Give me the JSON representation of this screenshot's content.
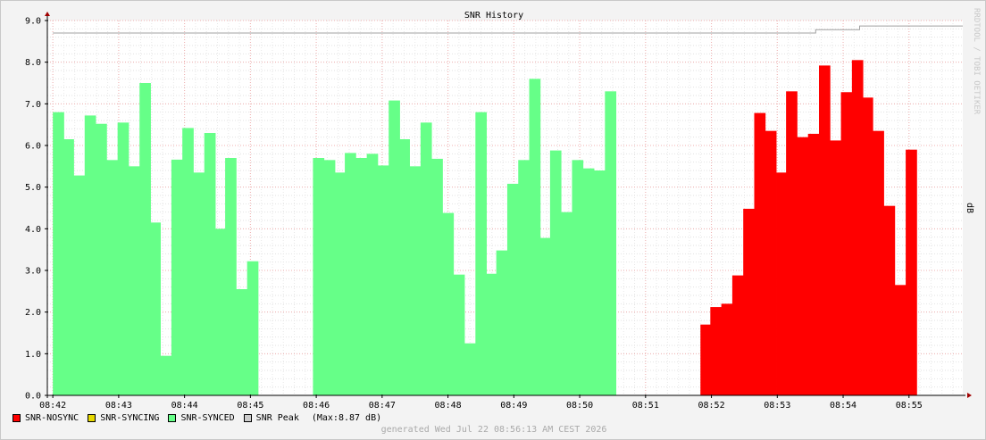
{
  "chart_data": {
    "type": "bar",
    "title": "SNR History",
    "ylabel": "dB",
    "ylim": [
      0,
      9
    ],
    "yticks": [
      "0.0",
      "1.0",
      "2.0",
      "3.0",
      "4.0",
      "5.0",
      "6.0",
      "7.0",
      "8.0",
      "9.0"
    ],
    "xlim": [
      "08:41:55",
      "08:55:49"
    ],
    "xticks": [
      "08:42",
      "08:43",
      "08:44",
      "08:45",
      "08:46",
      "08:47",
      "08:48",
      "08:49",
      "08:50",
      "08:51",
      "08:52",
      "08:53",
      "08:54",
      "08:55"
    ],
    "grid": true,
    "legend_position": "bottom-left",
    "series": [
      {
        "name": "SNR-NOSYNC",
        "color": "#ff0000",
        "points": [
          [
            "08:51:50",
            1.7
          ],
          [
            "08:51:59",
            2.12
          ],
          [
            "08:52:09",
            2.2
          ],
          [
            "08:52:19",
            2.88
          ],
          [
            "08:52:29",
            4.48
          ],
          [
            "08:52:39",
            6.78
          ],
          [
            "08:52:49",
            6.35
          ],
          [
            "08:52:59",
            5.35
          ],
          [
            "08:53:08",
            7.3
          ],
          [
            "08:53:18",
            6.2
          ],
          [
            "08:53:28",
            6.28
          ],
          [
            "08:53:38",
            7.92
          ],
          [
            "08:53:48",
            6.12
          ],
          [
            "08:53:58",
            7.28
          ],
          [
            "08:54:08",
            8.05
          ],
          [
            "08:54:17",
            7.15
          ],
          [
            "08:54:27",
            6.35
          ],
          [
            "08:54:37",
            4.55
          ],
          [
            "08:54:47",
            2.65
          ],
          [
            "08:54:57",
            5.9
          ]
        ]
      },
      {
        "name": "SNR-SYNCING",
        "color": "#e6d800",
        "points": []
      },
      {
        "name": "SNR-SYNCED",
        "color": "#66ff88",
        "points": [
          [
            "08:42:00",
            6.8
          ],
          [
            "08:42:09",
            6.15
          ],
          [
            "08:42:19",
            5.28
          ],
          [
            "08:42:29",
            6.72
          ],
          [
            "08:42:39",
            6.52
          ],
          [
            "08:42:49",
            5.65
          ],
          [
            "08:42:59",
            6.55
          ],
          [
            "08:43:09",
            5.5
          ],
          [
            "08:43:19",
            7.5
          ],
          [
            "08:43:28",
            4.15
          ],
          [
            "08:43:38",
            0.95
          ],
          [
            "08:43:48",
            5.66
          ],
          [
            "08:43:58",
            6.42
          ],
          [
            "08:44:08",
            5.35
          ],
          [
            "08:44:18",
            6.3
          ],
          [
            "08:44:28",
            4.0
          ],
          [
            "08:44:37",
            5.7
          ],
          [
            "08:44:47",
            2.55
          ],
          [
            "08:44:57",
            3.22
          ],
          [
            "08:45:57",
            5.7
          ],
          [
            "08:46:07",
            5.65
          ],
          [
            "08:46:16",
            5.35
          ],
          [
            "08:46:26",
            5.82
          ],
          [
            "08:46:36",
            5.7
          ],
          [
            "08:46:46",
            5.8
          ],
          [
            "08:46:56",
            5.52
          ],
          [
            "08:47:06",
            7.08
          ],
          [
            "08:47:15",
            6.15
          ],
          [
            "08:47:25",
            5.5
          ],
          [
            "08:47:35",
            6.55
          ],
          [
            "08:47:45",
            5.68
          ],
          [
            "08:47:55",
            4.38
          ],
          [
            "08:48:05",
            2.9
          ],
          [
            "08:48:15",
            1.25
          ],
          [
            "08:48:25",
            6.8
          ],
          [
            "08:48:34",
            2.92
          ],
          [
            "08:48:44",
            3.48
          ],
          [
            "08:48:54",
            5.08
          ],
          [
            "08:49:04",
            5.65
          ],
          [
            "08:49:14",
            7.6
          ],
          [
            "08:49:24",
            3.78
          ],
          [
            "08:49:33",
            5.88
          ],
          [
            "08:49:43",
            4.4
          ],
          [
            "08:49:53",
            5.65
          ],
          [
            "08:50:03",
            5.45
          ],
          [
            "08:50:13",
            5.4
          ],
          [
            "08:50:23",
            7.3
          ]
        ]
      },
      {
        "name": "SNR Peak",
        "color": "#cccccc",
        "line_color": "#a0a0a0",
        "points": [
          [
            "08:42:00",
            8.7
          ],
          [
            "08:53:35",
            8.7
          ],
          [
            "08:53:35",
            8.78
          ],
          [
            "08:54:15",
            8.78
          ],
          [
            "08:54:15",
            8.87
          ],
          [
            "08:55:49",
            8.87
          ]
        ]
      }
    ],
    "peak_note": "(Max:8.87 dB)"
  },
  "watermark": "RRDTOOL / TOBI OETIKER",
  "footer": "generated Wed Jul 22 08:56:13 AM CEST 2026"
}
